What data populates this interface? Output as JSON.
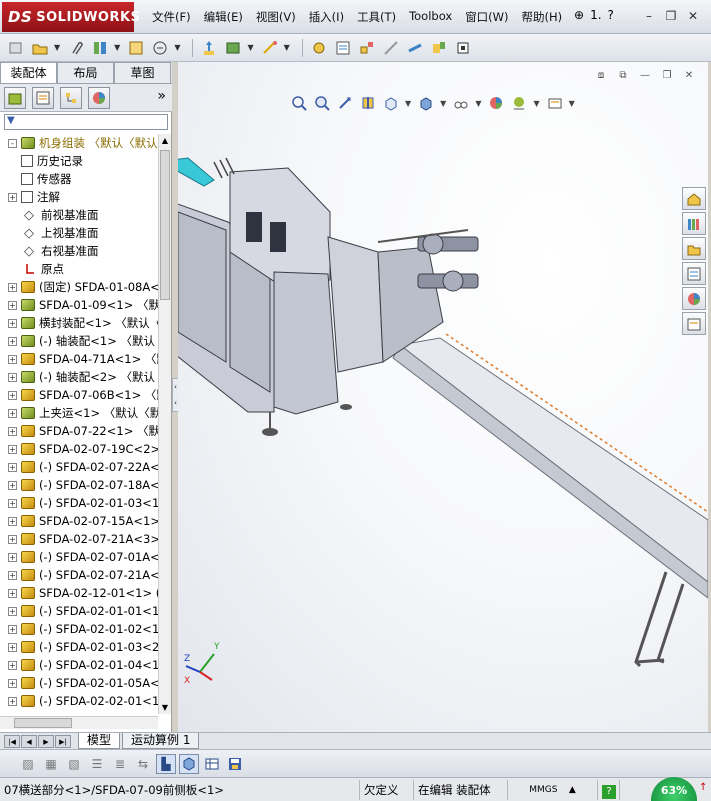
{
  "app": {
    "logo_prefix": "DS",
    "logo_text": "SOLIDWORKS"
  },
  "menu": [
    "文件(F)",
    "编辑(E)",
    "视图(V)",
    "插入(I)",
    "工具(T)",
    "Toolbox",
    "窗口(W)",
    "帮助(H)"
  ],
  "title_extras": {
    "help_glyph": "?",
    "pin_glyph": "⊕",
    "ellipsis": "1."
  },
  "window_controls": [
    "–",
    "❐",
    "✕"
  ],
  "left_panel": {
    "tabs": [
      "装配体",
      "布局",
      "草图"
    ],
    "more": "»",
    "filter_glyph": "▼",
    "tree": [
      {
        "label": "机身组装  〈默认〈默认",
        "icon": "asm",
        "expander": "-",
        "root": true
      },
      {
        "label": "历史记录",
        "icon": "hist",
        "expander": ""
      },
      {
        "label": "传感器",
        "icon": "hist",
        "expander": ""
      },
      {
        "label": "注解",
        "icon": "hist",
        "expander": "+"
      },
      {
        "label": "前视基准面",
        "icon": "plane",
        "expander": ""
      },
      {
        "label": "上视基准面",
        "icon": "plane",
        "expander": ""
      },
      {
        "label": "右视基准面",
        "icon": "plane",
        "expander": ""
      },
      {
        "label": "原点",
        "icon": "origin",
        "expander": ""
      },
      {
        "label": "(固定) SFDA-01-08A<",
        "icon": "part",
        "expander": "+"
      },
      {
        "label": "SFDA-01-09<1> 〈默认",
        "icon": "asm",
        "expander": "+"
      },
      {
        "label": "横封装配<1> 〈默认〈",
        "icon": "asm",
        "expander": "+"
      },
      {
        "label": "(-) 轴装配<1> 〈默认",
        "icon": "asm",
        "expander": "+"
      },
      {
        "label": "SFDA-04-71A<1> 〈默",
        "icon": "part",
        "expander": "+"
      },
      {
        "label": "(-) 轴装配<2> 〈默认",
        "icon": "asm",
        "expander": "+"
      },
      {
        "label": "SFDA-07-06B<1> 〈默",
        "icon": "part",
        "expander": "+"
      },
      {
        "label": "上夹运<1> 〈默认〈默",
        "icon": "asm",
        "expander": "+"
      },
      {
        "label": "SFDA-07-22<1> 〈默认",
        "icon": "part",
        "expander": "+"
      },
      {
        "label": "SFDA-02-07-19C<2> (",
        "icon": "part",
        "expander": "+"
      },
      {
        "label": "(-) SFDA-02-07-22A<",
        "icon": "part",
        "expander": "+"
      },
      {
        "label": "(-) SFDA-02-07-18A<",
        "icon": "part",
        "expander": "+"
      },
      {
        "label": "(-) SFDA-02-01-03<1",
        "icon": "part",
        "expander": "+"
      },
      {
        "label": "SFDA-02-07-15A<1> (",
        "icon": "part",
        "expander": "+"
      },
      {
        "label": "SFDA-02-07-21A<3> (",
        "icon": "part",
        "expander": "+"
      },
      {
        "label": "(-) SFDA-02-07-01A<",
        "icon": "part",
        "expander": "+"
      },
      {
        "label": "(-) SFDA-02-07-21A<",
        "icon": "part",
        "expander": "+"
      },
      {
        "label": "SFDA-02-12-01<1> (",
        "icon": "part",
        "expander": "+"
      },
      {
        "label": "(-) SFDA-02-01-01<1",
        "icon": "part",
        "expander": "+"
      },
      {
        "label": "(-) SFDA-02-01-02<1",
        "icon": "part",
        "expander": "+"
      },
      {
        "label": "(-) SFDA-02-01-03<2",
        "icon": "part",
        "expander": "+"
      },
      {
        "label": "(-) SFDA-02-01-04<1",
        "icon": "part",
        "expander": "+"
      },
      {
        "label": "(-) SFDA-02-01-05A<",
        "icon": "part",
        "expander": "+"
      },
      {
        "label": "(-) SFDA-02-02-01<1",
        "icon": "part",
        "expander": "+"
      }
    ]
  },
  "bottom_tabs": [
    "模型",
    "运动算例 1"
  ],
  "status": {
    "path": "07横送部分<1>/SFDA-07-09前侧板<1>",
    "state": "欠定义",
    "mode": "在编辑 装配体",
    "units": "MMGS",
    "help": "?",
    "zoom": "63%"
  },
  "triad": {
    "x": "X",
    "y": "Y",
    "z": "Z"
  },
  "colors": {
    "accent": "#c8262c",
    "model_body": "#c9ccd6",
    "conveyor": "#e4e7ee",
    "cyan_part": "#38c8d8"
  }
}
